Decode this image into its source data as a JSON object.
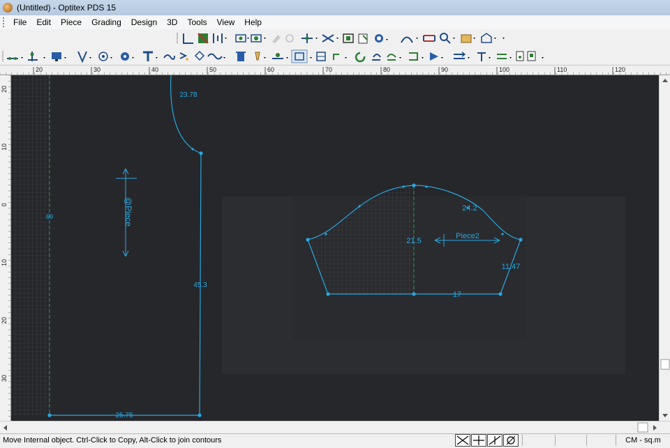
{
  "window": {
    "title": "(Untitled) - Optitex PDS 15"
  },
  "menu": {
    "items": [
      "File",
      "Edit",
      "Piece",
      "Grading",
      "Design",
      "3D",
      "Tools",
      "View",
      "Help"
    ]
  },
  "ruler": {
    "h_ticks": [
      "20",
      "30",
      "40",
      "50",
      "60",
      "70",
      "80",
      "90",
      "100",
      "110",
      "120"
    ],
    "v_ticks": [
      "20",
      "10",
      "0",
      "10",
      "20",
      "30"
    ]
  },
  "canvas": {
    "piece1": {
      "label": "@Piece",
      "dims": {
        "top_curve": "23.78",
        "left_edge": "69",
        "right_edge": "45.3",
        "bottom_edge": "25.75"
      }
    },
    "piece2": {
      "label": "Piece2",
      "dims": {
        "center": "21.5",
        "curve_right": "24.2",
        "side_right": "11.47",
        "bottom": "17"
      }
    },
    "colors": {
      "background": "#26272b",
      "line": "#29a8e0",
      "grid": "#4a4d52"
    }
  },
  "statusbar": {
    "message": "Move Internal object. Ctrl-Click to Copy, Alt-Click to join contours",
    "units": "CM - sq.m"
  }
}
